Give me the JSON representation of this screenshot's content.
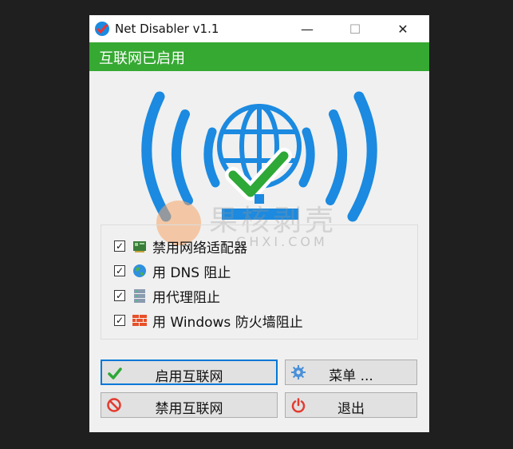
{
  "window": {
    "title": "Net Disabler v1.1",
    "minimize": "—",
    "maximize": "☐",
    "close": "✕"
  },
  "status": {
    "text": "互联网已启用",
    "color": "#36a933"
  },
  "hero_icon": "globe-wifi-check-icon",
  "watermark": {
    "main": "果核剥壳",
    "sub": "GHXI.COM"
  },
  "options": [
    {
      "label": "禁用网络适配器",
      "checked": true,
      "icon": "network-adapter-icon",
      "mark": "✓"
    },
    {
      "label": "用 DNS 阻止",
      "checked": true,
      "icon": "globe-icon",
      "mark": "✓"
    },
    {
      "label": "用代理阻止",
      "checked": true,
      "icon": "server-icon",
      "mark": "✓"
    },
    {
      "label": "用 Windows 防火墙阻止",
      "checked": true,
      "icon": "firewall-icon",
      "mark": "✓"
    }
  ],
  "buttons": {
    "enable": {
      "label": "启用互联网",
      "icon": "check-icon"
    },
    "menu": {
      "label": "菜单 ...",
      "icon": "gear-icon"
    },
    "disable": {
      "label": "禁用互联网",
      "icon": "no-entry-icon"
    },
    "exit": {
      "label": "退出",
      "icon": "power-icon"
    }
  },
  "colors": {
    "accent_blue": "#1b8ae0",
    "check_green": "#2ea836",
    "button_focus": "#0078d7"
  }
}
